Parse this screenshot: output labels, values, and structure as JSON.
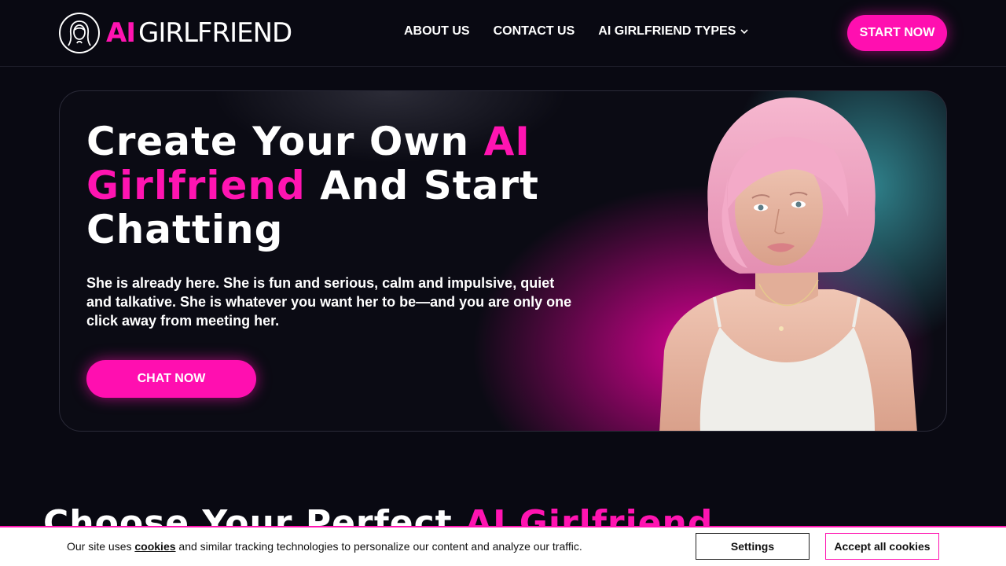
{
  "header": {
    "logo_ai": "AI",
    "logo_name": "GIRLFRIEND",
    "nav": [
      {
        "label": "ABOUT US"
      },
      {
        "label": "CONTACT US"
      },
      {
        "label": "AI GIRLFRIEND TYPES"
      }
    ],
    "cta_label": "START NOW"
  },
  "hero": {
    "title_part1": "Create Your Own ",
    "title_highlight1": "AI Girlfriend",
    "title_part2": " And Start Chatting",
    "subtitle": "She is already here. She is fun and serious, calm and impulsive, quiet and talkative. She is whatever you want her to be—and you are only one click away from meeting her.",
    "button_label": "CHAT NOW"
  },
  "section": {
    "title_part1": "Choose Your Perfect ",
    "title_highlight": "AI Girlfriend"
  },
  "cookie_banner": {
    "text_before": "Our site uses ",
    "link_label": "cookies",
    "text_after": " and similar tracking technologies to personalize our content and analyze our traffic.",
    "settings_label": "Settings",
    "accept_label": "Accept all cookies"
  },
  "colors": {
    "accent": "#ff14b1",
    "background": "#090912",
    "teal_glow": "#3caab4"
  }
}
